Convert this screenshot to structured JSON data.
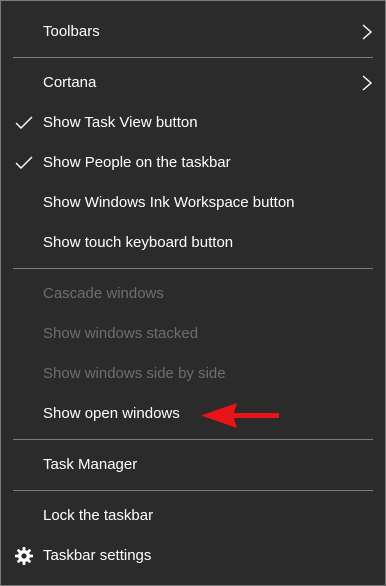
{
  "menu": {
    "items": [
      {
        "label": "Toolbars"
      },
      {
        "label": "Cortana"
      },
      {
        "label": "Show Task View button"
      },
      {
        "label": "Show People on the taskbar"
      },
      {
        "label": "Show Windows Ink Workspace button"
      },
      {
        "label": "Show touch keyboard button"
      },
      {
        "label": "Cascade windows"
      },
      {
        "label": "Show windows stacked"
      },
      {
        "label": "Show windows side by side"
      },
      {
        "label": "Show open windows"
      },
      {
        "label": "Task Manager"
      },
      {
        "label": "Lock the taskbar"
      },
      {
        "label": "Taskbar settings"
      }
    ]
  },
  "state": {
    "show_task_view_button_checked": true,
    "show_people_on_taskbar_checked": true,
    "cascade_windows_enabled": false,
    "show_windows_stacked_enabled": false,
    "show_windows_side_by_side_enabled": false
  },
  "icons": {
    "toolbars": "chevron-right-icon",
    "cortana": "chevron-right-icon",
    "task_view": "checkmark-icon",
    "people": "checkmark-icon",
    "settings": "gear-icon",
    "annotation": "red-arrow-icon"
  },
  "colors": {
    "background": "#2b2b2b",
    "text": "#ffffff",
    "disabled_text": "#6d6d6d",
    "separator": "#7b7b7b",
    "annotation_arrow": "#e8141a"
  }
}
